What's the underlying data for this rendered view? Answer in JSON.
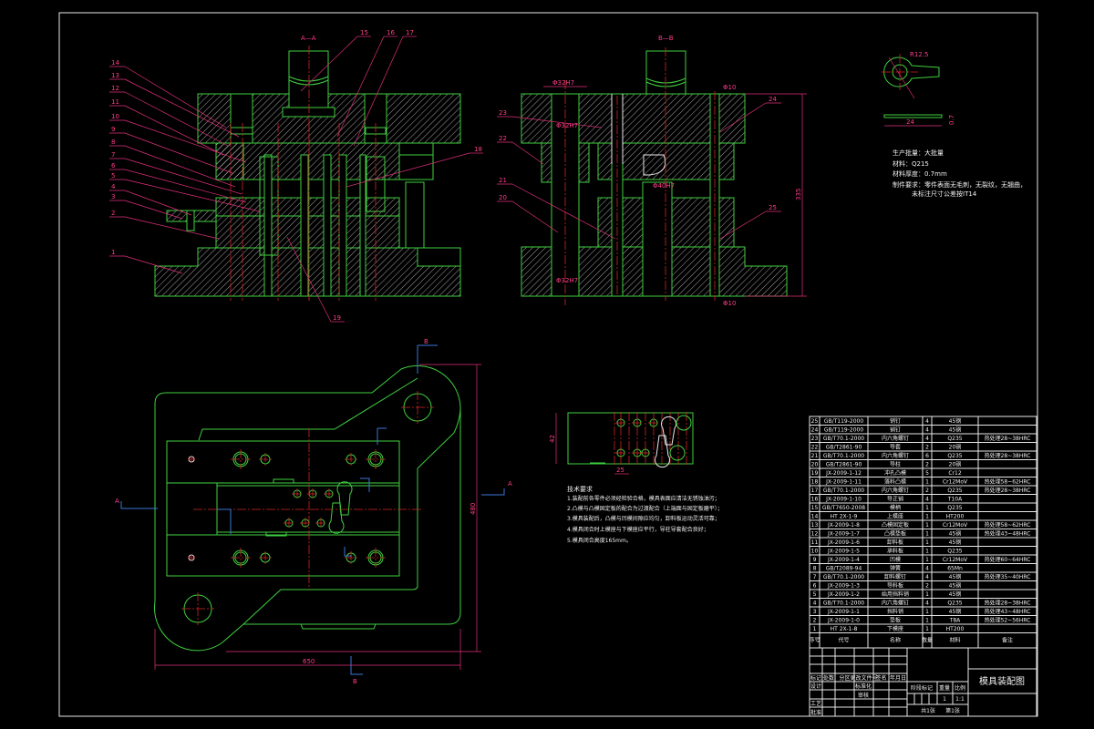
{
  "drawing": {
    "section_aa_label": "A—A",
    "section_bb_label": "B—B",
    "section_marker_a": "A",
    "section_marker_b": "B",
    "callouts_aa_left": [
      "14",
      "13",
      "12",
      "11",
      "10",
      "9",
      "8",
      "7",
      "6",
      "5",
      "4",
      "3",
      "2",
      "1"
    ],
    "callouts_aa_top": [
      "15",
      "16",
      "17"
    ],
    "callout_aa_right": "18",
    "callout_aa_bottom": "19",
    "callouts_bb_left": [
      "23",
      "22",
      "21",
      "20"
    ],
    "callouts_bb_right": [
      "24",
      "25"
    ],
    "dimensions": {
      "bb_height": "335",
      "bb_guide_top": "Φ32H7",
      "bb_guide_mid": "Φ32H7",
      "bb_guide_bottom": "Φ32H7",
      "bb_pin_top": "Φ10",
      "bb_pin_bottom": "Φ10",
      "bb_punch": "Φ40H7",
      "plan_width": "650",
      "plan_height": "480",
      "strip_width": "42",
      "strip_pitch": "25",
      "part_diameter": "R12.5",
      "part_length": "24",
      "part_thickness": "0.7"
    },
    "colors": {
      "outline": "#3fcf3f",
      "hatch": "#e8e8e8",
      "centerline": "#d42424",
      "annotation": "#ff3d8a",
      "section_line": "#3a78d8",
      "background": "#000000"
    }
  },
  "specs": [
    "生产批量：大批量",
    "材料：Q215",
    "材料厚度：0.7mm",
    "制件要求：零件表面无毛刺，无裂纹，无翘曲，",
    "未标注尺寸公差按IT14"
  ],
  "notes": {
    "title": "技术要求",
    "items": [
      "1.装配前各零件必须经检验合格，模具表面应清洁无锈蚀油污；",
      "2.凸模与凸模固定板的配合为过渡配合（上端面与固定板磨平）；",
      "3.模具装配后，凸模与凹模间隙应均匀，卸料板运动灵活可靠；",
      "4.模具闭合时上模座与下模座应平行，导柱导套配合良好；",
      "5.模具闭合高度165mm。"
    ]
  },
  "parts_list": {
    "header": [
      "序号",
      "代号",
      "名称",
      "数量",
      "材料",
      "备注"
    ],
    "rows": [
      [
        "25",
        "GB/T119-2000",
        "销钉",
        "4",
        "45钢",
        ""
      ],
      [
        "24",
        "GB/T119-2000",
        "销钉",
        "4",
        "45钢",
        ""
      ],
      [
        "23",
        "GB/T70.1-2000",
        "内六角螺钉",
        "4",
        "Q235",
        "热处理28~38HRC"
      ],
      [
        "22",
        "GB/T2861-90",
        "导套",
        "2",
        "20钢",
        ""
      ],
      [
        "21",
        "GB/T70.1-2000",
        "内六角螺钉",
        "6",
        "Q235",
        "热处理28~38HRC"
      ],
      [
        "20",
        "GB/T2861-90",
        "导柱",
        "2",
        "20钢",
        ""
      ],
      [
        "19",
        "JX-2009-1-12",
        "冲孔凸模",
        "5",
        "Cr12",
        ""
      ],
      [
        "18",
        "JX-2009-1-11",
        "落料凸模",
        "1",
        "Cr12MoV",
        "热处理58~62HRC"
      ],
      [
        "17",
        "GB/T70.1-2000",
        "内六角螺钉",
        "2",
        "Q235",
        "热处理28~38HRC"
      ],
      [
        "16",
        "JX-2009-1-10",
        "导正销",
        "4",
        "T10A",
        ""
      ],
      [
        "15",
        "GB/T7650-2008",
        "模柄",
        "1",
        "Q235",
        ""
      ],
      [
        "14",
        "HT 2X-1-9",
        "上模座",
        "1",
        "HT200",
        ""
      ],
      [
        "13",
        "JX-2009-1-8",
        "凸模固定板",
        "1",
        "Cr12MoV",
        "热处理58~62HRC"
      ],
      [
        "12",
        "JX-2009-1-7",
        "凸模垫板",
        "1",
        "45钢",
        "热处理43~48HRC"
      ],
      [
        "11",
        "JX-2009-1-6",
        "卸料板",
        "1",
        "45钢",
        ""
      ],
      [
        "10",
        "JX-2009-1-5",
        "承料板",
        "1",
        "Q235",
        ""
      ],
      [
        "9",
        "JX-2009-1-4",
        "凹模",
        "1",
        "Cr12MoV",
        "热处理60~64HRC"
      ],
      [
        "8",
        "GB/T2089-94",
        "弹簧",
        "4",
        "65Mn",
        ""
      ],
      [
        "7",
        "GB/T70.1-2000",
        "卸料螺钉",
        "4",
        "45钢",
        "热处理35~40HRC"
      ],
      [
        "6",
        "JX-2009-1-3",
        "导料板",
        "2",
        "45钢",
        ""
      ],
      [
        "5",
        "JX-2009-1-2",
        "始用挡料销",
        "1",
        "45钢",
        ""
      ],
      [
        "4",
        "GB/T70.1-2000",
        "内六角螺钉",
        "4",
        "Q235",
        "热处理28~38HRC"
      ],
      [
        "3",
        "JX-2009-1-1",
        "挡料销",
        "1",
        "45钢",
        "热处理43~48HRC"
      ],
      [
        "2",
        "JX-2009-1-0",
        "垫板",
        "1",
        "T8A",
        "热处理52~56HRC"
      ],
      [
        "1",
        "HT 2X-1-8",
        "下模座",
        "1",
        "HT200",
        ""
      ]
    ]
  },
  "title_block": {
    "title": "模具装配图",
    "revision_headers": [
      "标记",
      "处数",
      "分区",
      "更改文件号",
      "签名",
      "年月日"
    ],
    "roles": [
      "设计",
      "标准化",
      "审核",
      "工艺",
      "批准"
    ],
    "stage_headers": [
      "阶段标记",
      "重量",
      "比例"
    ],
    "weight": "1",
    "scale": "1:1",
    "sheet_total": "共1张",
    "sheet_number": "第1张"
  }
}
